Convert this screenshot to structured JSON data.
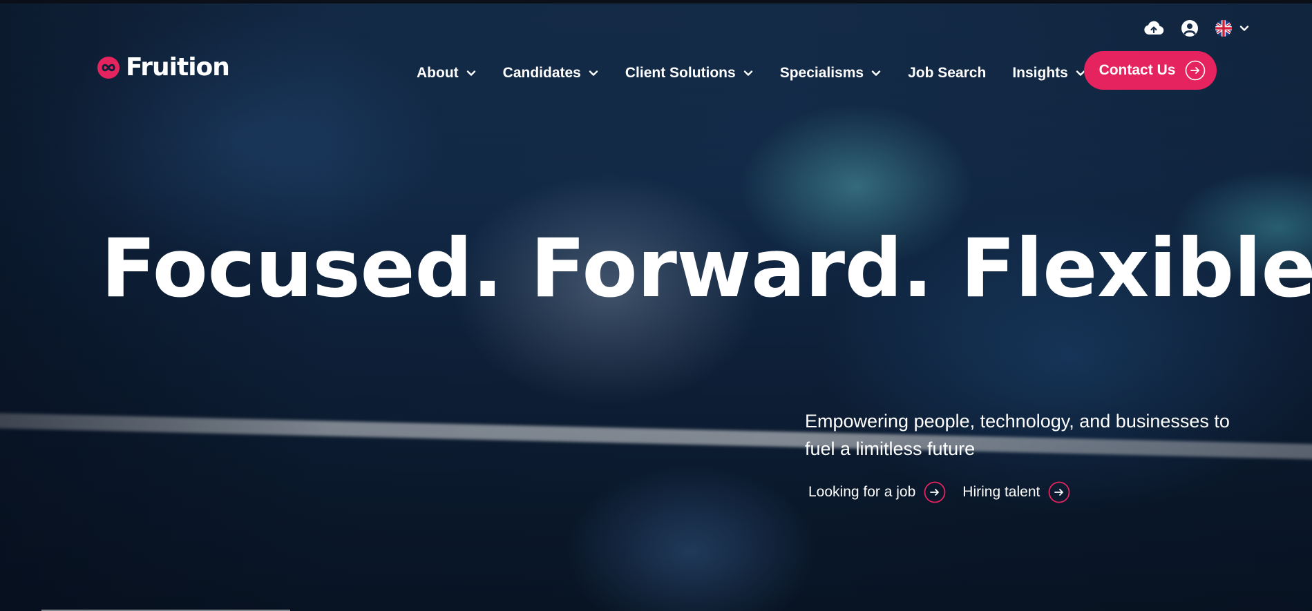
{
  "brand": {
    "name": "Fruition",
    "accent_color": "#e5235f"
  },
  "utility": {
    "upload_icon": "cloud-upload-icon",
    "account_icon": "user-circle-icon",
    "language_icon": "uk-flag-icon",
    "language_chevron": "chevron-down-icon"
  },
  "nav": {
    "items": [
      {
        "label": "About",
        "has_dropdown": true
      },
      {
        "label": "Candidates",
        "has_dropdown": true
      },
      {
        "label": "Client Solutions",
        "has_dropdown": true
      },
      {
        "label": "Specialisms",
        "has_dropdown": true
      },
      {
        "label": "Job Search",
        "has_dropdown": false
      },
      {
        "label": "Insights",
        "has_dropdown": true
      }
    ],
    "contact_label": "Contact Us"
  },
  "hero": {
    "headline": "Focused. Forward. Flexible.",
    "subheading": "Empowering people, technology, and businesses to fuel a limitless future",
    "cta_job": "Looking for a job",
    "cta_hire": "Hiring talent"
  }
}
